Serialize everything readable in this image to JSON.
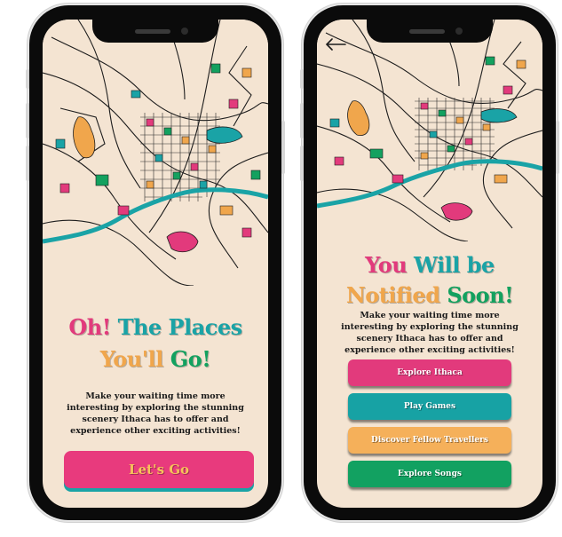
{
  "screen_left": {
    "title_line1": [
      {
        "text": "Oh!",
        "color": "#e23a7c"
      },
      {
        "text": "The Places",
        "color": "#1aa3a6"
      }
    ],
    "title_line2": [
      {
        "text": "You'll",
        "color": "#f0a64c"
      },
      {
        "text": "Go!",
        "color": "#13a15f"
      }
    ],
    "description": "Make your waiting time more interesting by exploring the stunning scenery Ithaca has to offer and experience other exciting activities!",
    "cta_label": "Let's Go"
  },
  "screen_right": {
    "back_icon": "arrow-left-icon",
    "title_line1": [
      {
        "text": "You",
        "color": "#e23a7c"
      },
      {
        "text": "Will be",
        "color": "#1aa3a6"
      }
    ],
    "title_line2": [
      {
        "text": "Notified",
        "color": "#f0a64c"
      },
      {
        "text": "Soon!",
        "color": "#13a15f"
      }
    ],
    "description": "Make your waiting time more interesting by exploring the stunning scenery Ithaca has to offer and experience other exciting activities!",
    "buttons": [
      {
        "label": "Explore Ithaca",
        "color": "#e23a7c"
      },
      {
        "label": "Play Games",
        "color": "#17a2a4"
      },
      {
        "label": "Discover Fellow Travellers",
        "color": "#f5b05a"
      },
      {
        "label": "Explore Songs",
        "color": "#12a161"
      }
    ]
  }
}
